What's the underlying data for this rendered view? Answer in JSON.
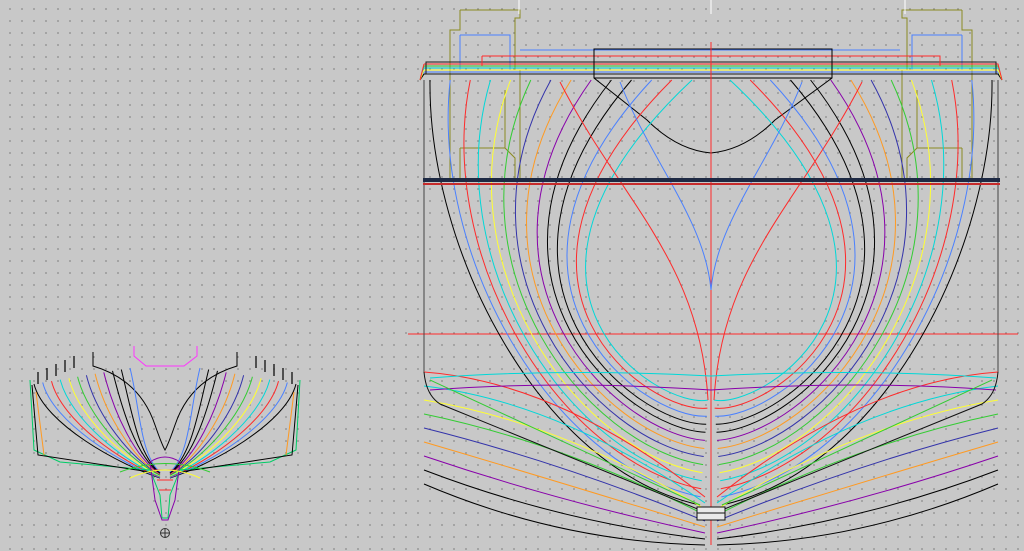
{
  "palette": {
    "background": "#c8c8c8",
    "grid_dot": "#8c8c8c",
    "axis": "#ff2a2a",
    "waterline": "#1e2a44",
    "deck": "#8a8a22",
    "station_colors": [
      "#000000",
      "#4a80ff",
      "#ff2a2a",
      "#00d8d8",
      "#ffff33",
      "#33cc33",
      "#3333aa",
      "#ff9a22",
      "#8800aa",
      "#000000"
    ]
  },
  "views": [
    {
      "name": "small-body-plan",
      "icon": "origin-marker-icon"
    },
    {
      "name": "large-body-plan"
    }
  ],
  "icons": [
    "origin-marker-icon"
  ]
}
